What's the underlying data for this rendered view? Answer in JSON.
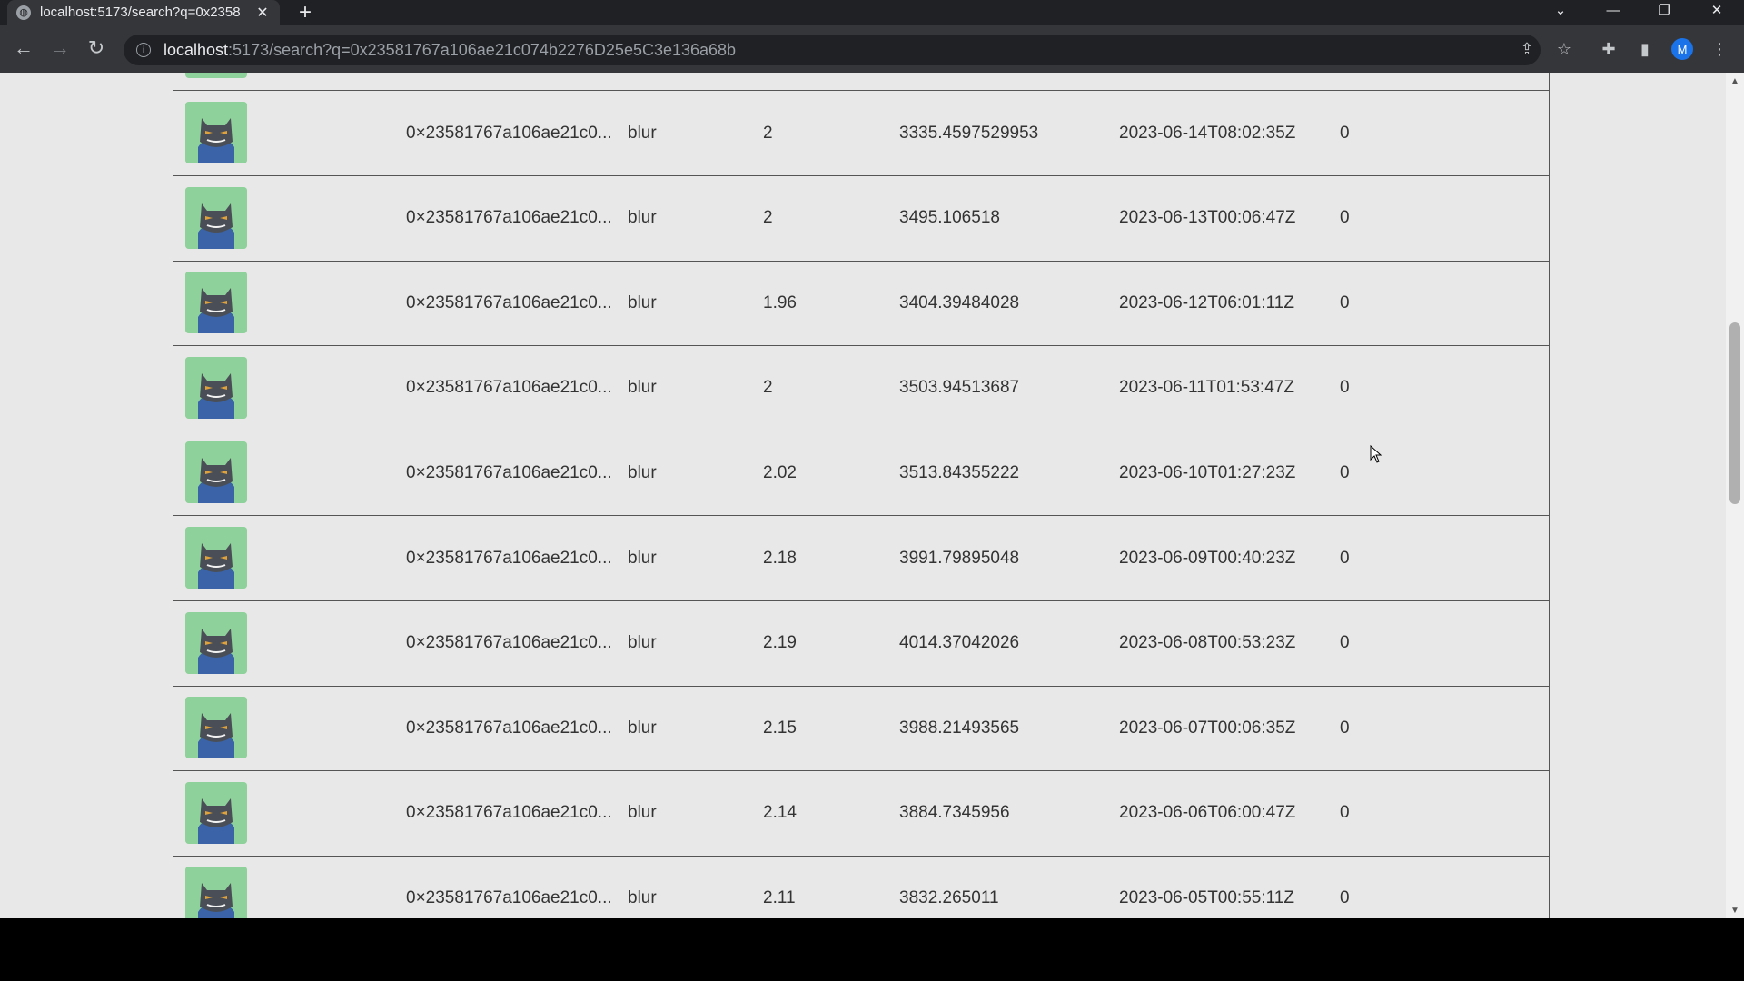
{
  "browser": {
    "tab_title": "localhost:5173/search?q=0x2358",
    "url_host": "localhost",
    "url_rest": ":5173/search?q=0x23581767a106ae21c074b2276D25e5C3e136a68b",
    "profile_initial": "M"
  },
  "icons": {
    "back": "back-arrow-icon",
    "forward": "forward-arrow-icon",
    "reload": "reload-icon",
    "info": "info-icon",
    "share": "share-icon",
    "star": "star-icon",
    "extensions": "puzzle-icon",
    "sidepanel": "side-panel-icon"
  },
  "colors": {
    "avatar_bg": "#8fd19a",
    "page_bg": "#e8e8e8"
  },
  "rows": [
    {
      "address": "0×23581767a106ae21c0...",
      "type": "blur",
      "price": "2",
      "usd": "3335.4597529953",
      "date": "2023-06-14T08:02:35Z",
      "count": "0"
    },
    {
      "address": "0×23581767a106ae21c0...",
      "type": "blur",
      "price": "2",
      "usd": "3495.106518",
      "date": "2023-06-13T00:06:47Z",
      "count": "0"
    },
    {
      "address": "0×23581767a106ae21c0...",
      "type": "blur",
      "price": "1.96",
      "usd": "3404.39484028",
      "date": "2023-06-12T06:01:11Z",
      "count": "0"
    },
    {
      "address": "0×23581767a106ae21c0...",
      "type": "blur",
      "price": "2",
      "usd": "3503.94513687",
      "date": "2023-06-11T01:53:47Z",
      "count": "0"
    },
    {
      "address": "0×23581767a106ae21c0...",
      "type": "blur",
      "price": "2.02",
      "usd": "3513.84355222",
      "date": "2023-06-10T01:27:23Z",
      "count": "0"
    },
    {
      "address": "0×23581767a106ae21c0...",
      "type": "blur",
      "price": "2.18",
      "usd": "3991.79895048",
      "date": "2023-06-09T00:40:23Z",
      "count": "0"
    },
    {
      "address": "0×23581767a106ae21c0...",
      "type": "blur",
      "price": "2.19",
      "usd": "4014.37042026",
      "date": "2023-06-08T00:53:23Z",
      "count": "0"
    },
    {
      "address": "0×23581767a106ae21c0...",
      "type": "blur",
      "price": "2.15",
      "usd": "3988.21493565",
      "date": "2023-06-07T00:06:35Z",
      "count": "0"
    },
    {
      "address": "0×23581767a106ae21c0...",
      "type": "blur",
      "price": "2.14",
      "usd": "3884.7345956",
      "date": "2023-06-06T06:00:47Z",
      "count": "0"
    },
    {
      "address": "0×23581767a106ae21c0...",
      "type": "blur",
      "price": "2.11",
      "usd": "3832.265011",
      "date": "2023-06-05T00:55:11Z",
      "count": "0"
    }
  ]
}
